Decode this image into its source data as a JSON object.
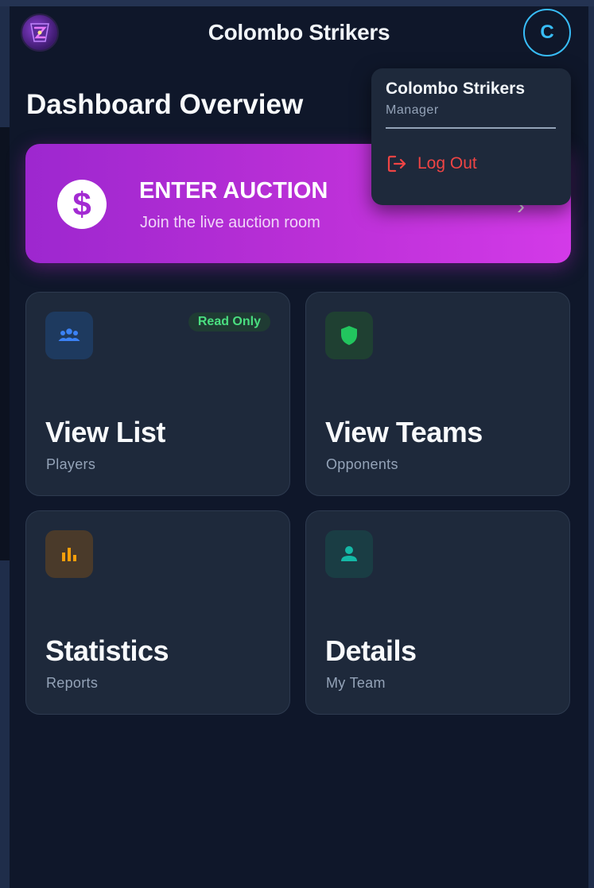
{
  "header": {
    "title": "Colombo Strikers",
    "avatar_initial": "C"
  },
  "page": {
    "title": "Dashboard Overview"
  },
  "auction": {
    "icon": "dollar-icon",
    "title": "ENTER AUCTION",
    "subtitle": "Join the live auction room",
    "arrow": "chevron-right-icon"
  },
  "cards": [
    {
      "icon": "group-icon",
      "title": "View List",
      "subtitle": "Players",
      "badge": "Read Only",
      "icon_bg": "#1e3a5f",
      "icon_color": "#3b82f6"
    },
    {
      "icon": "shield-icon",
      "title": "View Teams",
      "subtitle": "Opponents",
      "icon_bg": "#1f4032",
      "icon_color": "#22c55e"
    },
    {
      "icon": "bar-chart-icon",
      "title": "Statistics",
      "subtitle": "Reports",
      "icon_bg": "#4a3a2a",
      "icon_color": "#f59e0b"
    },
    {
      "icon": "person-icon",
      "title": "Details",
      "subtitle": "My Team",
      "icon_bg": "#1a3d44",
      "icon_color": "#14b8a6"
    }
  ],
  "user_menu": {
    "name": "Colombo Strikers",
    "role": "Manager",
    "logout_label": "Log Out",
    "logout_color": "#ef4444"
  },
  "colors": {
    "background": "#0f172a",
    "card": "#1e293b",
    "accent": "#38bdf8",
    "auction_gradient_start": "#9d27cf",
    "auction_gradient_end": "#d33ae8"
  }
}
